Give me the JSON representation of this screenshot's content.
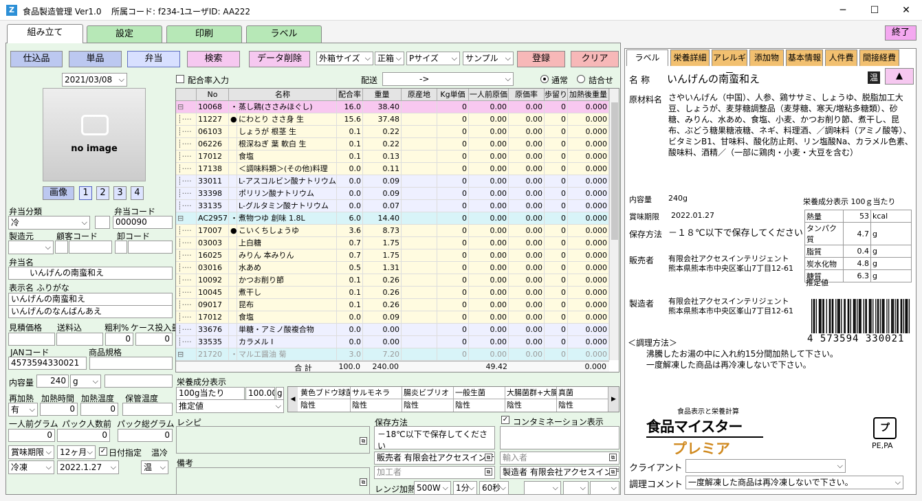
{
  "window": {
    "app_title": "食品製造管理 Ver1.0",
    "dept_code": "所属コード: f234-1",
    "user_id": "ユーザID: AA222"
  },
  "tabs": [
    "組み立て",
    "設定",
    "印刷",
    "ラベル"
  ],
  "end_button": "終了",
  "toolbar": {
    "shikomi": "仕込品",
    "tanpin": "単品",
    "bento": "弁当",
    "search": "検索",
    "delete": "データ削除",
    "box_size": "外箱サイズ",
    "direction": "正箱",
    "p_size": "Pサイズ",
    "sample": "サンプル",
    "register": "登録",
    "clear": "クリア"
  },
  "date_value": "2021/03/08",
  "image": {
    "placeholder": "no image",
    "button": "画像",
    "pages": [
      "1",
      "2",
      "3",
      "4"
    ]
  },
  "form": {
    "bento_class_label": "弁当分類",
    "bento_class_value": "冷",
    "bento_code_label": "弁当コード",
    "bento_code_value": "000090",
    "maker_label": "製造元",
    "customer_code_label": "顧客コード",
    "wholesale_label": "卸コード",
    "bento_name_label": "弁当名",
    "bento_name_value": "いんげんの南蛮和え",
    "display_name_label": "表示名 ふりがな",
    "display_name_value": "いんげんの南蛮和え",
    "furigana_value": "いんげんのなんばんあえ",
    "estimate_label": "見積価格",
    "shipping_label": "送料込",
    "gross_label": "粗利%",
    "case_label": "ケース投入量",
    "gross_value": "0",
    "case_value": "0",
    "jan_label": "JANコード",
    "jan_value": "4573594330021",
    "spec_label": "商品規格",
    "content_label": "内容量",
    "content_value": "240",
    "content_unit": "g",
    "reheat_label": "再加熱",
    "heat_time_label": "加熱時間",
    "heat_temp_label": "加熱温度",
    "storage_temp_label": "保管温度",
    "reheat_value": "有",
    "heat_time_value": "0",
    "heat_temp_value": "0",
    "per_gram_label": "一人前グラム",
    "pack_count_label": "パック人数前",
    "pack_total_label": "パック総グラム",
    "per_gram_value": "0",
    "pack_count_value": "0",
    "pack_total_value": "0",
    "expiry_label": "賞味期限",
    "expiry_months": "12ヶ月",
    "date_spec_label": "日付指定",
    "temp_label": "温冷",
    "freeze_value": "冷凍",
    "expiry_date_value": "2022.1.27",
    "temp_value": "温"
  },
  "mix_label": "配合率入力",
  "delivery_label": "配送",
  "delivery_value": "->",
  "radio": {
    "normal": "通常",
    "assort": "詰合せ"
  },
  "grid": {
    "headers": [
      "No",
      "名称",
      "配合率",
      "重量",
      "原産地",
      "Kg単価",
      "一人前原価",
      "原価率",
      "歩留り",
      "加熱後重量"
    ],
    "rows": [
      [
        "10068",
        "・",
        "蒸し鶏(ささみほぐし)",
        "16.0",
        "38.40",
        "",
        "0",
        "0.00",
        "0.00",
        "0",
        "0.000"
      ],
      [
        "11227",
        "●",
        "にわとり ささ身 生",
        "15.6",
        "37.48",
        "",
        "0",
        "0.00",
        "0.00",
        "0",
        "0.000"
      ],
      [
        "06103",
        "",
        "しょうが 根茎 生",
        "0.1",
        "0.22",
        "",
        "0",
        "0.00",
        "0.00",
        "0",
        "0.000"
      ],
      [
        "06226",
        "",
        "根深ねぎ 葉 軟白 生",
        "0.1",
        "0.22",
        "",
        "0",
        "0.00",
        "0.00",
        "0",
        "0.000"
      ],
      [
        "17012",
        "",
        "食塩",
        "0.1",
        "0.13",
        "",
        "0",
        "0.00",
        "0.00",
        "0",
        "0.000"
      ],
      [
        "17138",
        "",
        "＜調味料類＞(その他)料理",
        "0.0",
        "0.11",
        "",
        "0",
        "0.00",
        "0.00",
        "0",
        "0.000"
      ],
      [
        "33011",
        "",
        "L-アスコルビン酸ナトリウム",
        "0.0",
        "0.09",
        "",
        "0",
        "0.00",
        "0.00",
        "0",
        "0.000"
      ],
      [
        "33398",
        "",
        "ポリリン酸ナトリウム",
        "0.0",
        "0.09",
        "",
        "0",
        "0.00",
        "0.00",
        "0",
        "0.000"
      ],
      [
        "33135",
        "",
        "L-グルタミン酸ナトリウム",
        "0.0",
        "0.07",
        "",
        "0",
        "0.00",
        "0.00",
        "0",
        "0.000"
      ],
      [
        "AC2957",
        "・",
        "煮物つゆ 創味 1.8L",
        "6.0",
        "14.40",
        "",
        "0",
        "0.00",
        "0.00",
        "0",
        "0.000"
      ],
      [
        "17007",
        "●",
        "こいくちしょうゆ",
        "3.6",
        "8.73",
        "",
        "0",
        "0.00",
        "0.00",
        "0",
        "0.000"
      ],
      [
        "03003",
        "",
        "上白糖",
        "0.7",
        "1.75",
        "",
        "0",
        "0.00",
        "0.00",
        "0",
        "0.000"
      ],
      [
        "16025",
        "",
        "みりん 本みりん",
        "0.7",
        "1.75",
        "",
        "0",
        "0.00",
        "0.00",
        "0",
        "0.000"
      ],
      [
        "03016",
        "",
        "水あめ",
        "0.5",
        "1.31",
        "",
        "0",
        "0.00",
        "0.00",
        "0",
        "0.000"
      ],
      [
        "10092",
        "",
        "かつお削り節",
        "0.1",
        "0.26",
        "",
        "0",
        "0.00",
        "0.00",
        "0",
        "0.000"
      ],
      [
        "10045",
        "",
        "煮干し",
        "0.1",
        "0.26",
        "",
        "0",
        "0.00",
        "0.00",
        "0",
        "0.000"
      ],
      [
        "09017",
        "",
        "昆布",
        "0.1",
        "0.26",
        "",
        "0",
        "0.00",
        "0.00",
        "0",
        "0.000"
      ],
      [
        "17012",
        "",
        "食塩",
        "0.0",
        "0.09",
        "",
        "0",
        "0.00",
        "0.00",
        "0",
        "0.000"
      ],
      [
        "33676",
        "",
        "単糖・アミノ酸複合物",
        "0.0",
        "0.00",
        "",
        "0",
        "0.00",
        "0.00",
        "0",
        "0.000"
      ],
      [
        "33535",
        "",
        "カラメル I",
        "0.0",
        "0.00",
        "",
        "0",
        "0.00",
        "0.00",
        "0",
        "0.000"
      ],
      [
        "21720",
        "・",
        "マルエ醤油 菊",
        "3.0",
        "7.20",
        "",
        "0",
        "0.00",
        "0.00",
        "0",
        "0.000"
      ]
    ],
    "total": {
      "label": "合 計",
      "mix": "100.0",
      "weight": "240.00",
      "cost": "49.42",
      "after": "0.000"
    }
  },
  "nutrition_panel": {
    "label": "栄養成分表示",
    "per": "100g当たり",
    "per_value": "100.00",
    "unit": "g",
    "estimate": "推定値",
    "microbes": [
      "黄色ブドウ球菌",
      "サルモネラ",
      "腸炎ビブリオ",
      "一般生菌",
      "大腸菌群+大腸",
      "真菌"
    ],
    "results": [
      "陰性",
      "陰性",
      "陰性",
      "陰性",
      "陰性",
      "陰性"
    ]
  },
  "recipe_label": "レシピ",
  "memo_label": "備考",
  "storage": {
    "label": "保存方法",
    "value": "－18℃以下で保存してください"
  },
  "contamination_label": "コンタミネーション表示",
  "seller_btn": "販売者 有限会社アクセスインテ",
  "importer_btn": "輸入者",
  "processor_btn": "加工者",
  "maker_btn": "製造者 有限会社アクセスインテ",
  "microwave": {
    "label": "レンジ加熱",
    "watt": "500W",
    "min": "1分",
    "sec": "60秒"
  },
  "right_tabs": [
    "ラベル",
    "栄養詳細",
    "アレルギー",
    "添加物",
    "基本情報",
    "人件費",
    "間接経費"
  ],
  "label": {
    "name_label": "名 称",
    "name_value": "いんげんの南蛮和え",
    "temp_badge": "温",
    "ingredients_label": "原材料名",
    "ingredients": "さやいんげん（中国）、人参、鶏ササミ、しょうゆ、脱脂加工大豆、しょうが、麦芽糖調整品（麦芽糖、寒天/増粘多糖類）、砂糖、みりん、水あめ、食塩、小麦、かつお削り節、煮干し、昆布、ぶどう糖果糖液糖、ネギ、料理酒、／調味料（アミノ酸等）、ビタミンB1、甘味料、酸化防止剤、リン塩酸Na、カラメル色素、酸味料、酒精／（一部に鶏肉・小麦・大豆を含む）",
    "content_label": "内容量",
    "content_value": "240g",
    "expiry_label": "賞味期限",
    "expiry_value": "2022.01.27",
    "storage_label": "保存方法",
    "storage_value": "－１８℃以下で保存してください",
    "seller_label": "販売者",
    "seller_name": "有限会社アクセスインテリジェント",
    "seller_addr": "熊本県熊本市中央区峯山7丁目12-61",
    "maker_label": "製造者",
    "maker_name": "有限会社アクセスインテリジェント",
    "maker_addr": "熊本県熊本市中央区峯山7丁目12-61",
    "nutri_title": "栄養成分表示 100ｇ当たり",
    "nutri": [
      [
        "熱量",
        "53",
        "kcal"
      ],
      [
        "タンパク質",
        "4.7",
        "g"
      ],
      [
        "脂質",
        "0.4",
        "g"
      ],
      [
        "炭水化物",
        "4.8",
        "g"
      ],
      [
        "糖質",
        "6.3",
        "g"
      ]
    ],
    "nutri_note": "推定値",
    "barcode_text": "4 573594 330021",
    "method_label": "＜調理方法＞",
    "method_1": "沸騰したお湯の中に入れ約15分間加熱して下さい。",
    "method_2": "一度解凍した商品は再冷凍しないで下さい。",
    "logo_small": "食品表示と栄養計算",
    "logo_main": "食品マイスター",
    "logo_sub": "プレミア",
    "recycle": "PE,PA",
    "client_label": "クライアント",
    "comment_label": "調理コメント",
    "comment_value": "一度解凍した商品は再冷凍しないで下さい。"
  },
  "colors": {
    "tab_green": "#b7e8b7",
    "panel_green": "#e8f6e8",
    "blue_btn": "#bcc8f0",
    "pink_btn": "#f6c8f0",
    "red_btn": "#f7b8b8",
    "right_tab": "#f2c070",
    "row_pink": "#f8c8f0",
    "row_yellow": "#fffbe0",
    "row_blue": "#eef0ff",
    "row_cyan": "#d8f4f8"
  }
}
